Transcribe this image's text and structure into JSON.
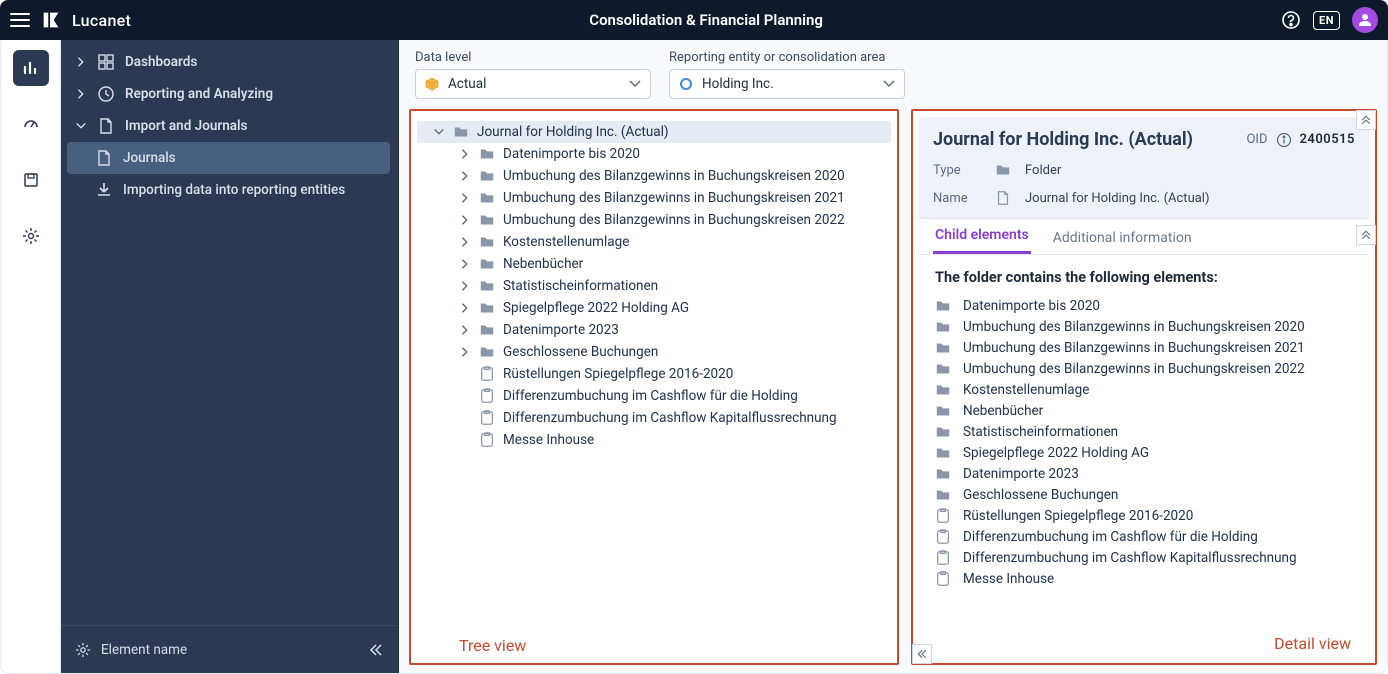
{
  "brand": "Lucanet",
  "app_title": "Consolidation & Financial Planning",
  "lang": "EN",
  "nav": {
    "items": [
      {
        "label": "Dashboards",
        "expandable": true,
        "open": false,
        "icon": "dashboard"
      },
      {
        "label": "Reporting and Analyzing",
        "expandable": true,
        "open": false,
        "icon": "clock"
      },
      {
        "label": "Import and Journals",
        "expandable": true,
        "open": true,
        "icon": "doc",
        "children": [
          {
            "label": "Journals",
            "icon": "doc",
            "active": true
          },
          {
            "label": "Importing data into reporting entities",
            "icon": "download"
          }
        ]
      }
    ],
    "footer_label": "Element name"
  },
  "filters": {
    "data_level": {
      "label": "Data level",
      "value": "Actual"
    },
    "entity": {
      "label": "Reporting entity or consolidation area",
      "value": "Holding Inc."
    }
  },
  "tree": {
    "root": "Journal for Holding Inc. (Actual)",
    "children": [
      {
        "label": "Datenimporte bis 2020",
        "type": "folder",
        "exp": true
      },
      {
        "label": "Umbuchung des Bilanzgewinns in Buchungskreisen 2020",
        "type": "folder",
        "exp": true
      },
      {
        "label": "Umbuchung des Bilanzgewinns in Buchungskreisen 2021",
        "type": "folder",
        "exp": true
      },
      {
        "label": "Umbuchung des Bilanzgewinns in Buchungskreisen 2022",
        "type": "folder",
        "exp": true
      },
      {
        "label": "Kostenstellenumlage",
        "type": "folder",
        "exp": true
      },
      {
        "label": "Nebenbücher",
        "type": "folder",
        "exp": true
      },
      {
        "label": "Statistischeinformationen",
        "type": "folder",
        "exp": true
      },
      {
        "label": "Spiegelpflege 2022 Holding AG",
        "type": "folder",
        "exp": true
      },
      {
        "label": "Datenimporte 2023",
        "type": "folder",
        "exp": true
      },
      {
        "label": "Geschlossene Buchungen",
        "type": "folder",
        "exp": true
      },
      {
        "label": "Rüstellungen Spiegelpflege 2016-2020",
        "type": "posting",
        "exp": false
      },
      {
        "label": "Differenzumbuchung im Cashflow für die Holding",
        "type": "posting",
        "exp": false
      },
      {
        "label": "Differenzumbuchung im Cashflow Kapitalflussrechnung",
        "type": "posting",
        "exp": false
      },
      {
        "label": "Messe Inhouse",
        "type": "posting",
        "exp": false
      }
    ],
    "caption": "Tree view"
  },
  "detail": {
    "title": "Journal for Holding Inc. (Actual)",
    "oid_label": "OID",
    "oid": "2400515",
    "type_label": "Type",
    "type_value": "Folder",
    "name_label": "Name",
    "name_value": "Journal for Holding Inc. (Actual)",
    "tabs": {
      "child": "Child elements",
      "info": "Additional information"
    },
    "list_heading": "The folder contains the following elements:",
    "elements": [
      {
        "label": "Datenimporte bis 2020",
        "type": "folder"
      },
      {
        "label": "Umbuchung des Bilanzgewinns in Buchungskreisen 2020",
        "type": "folder"
      },
      {
        "label": "Umbuchung des Bilanzgewinns in Buchungskreisen 2021",
        "type": "folder"
      },
      {
        "label": "Umbuchung des Bilanzgewinns in Buchungskreisen 2022",
        "type": "folder"
      },
      {
        "label": "Kostenstellenumlage",
        "type": "folder"
      },
      {
        "label": "Nebenbücher",
        "type": "folder"
      },
      {
        "label": "Statistischeinformationen",
        "type": "folder"
      },
      {
        "label": "Spiegelpflege 2022 Holding AG",
        "type": "folder"
      },
      {
        "label": "Datenimporte 2023",
        "type": "folder"
      },
      {
        "label": "Geschlossene Buchungen",
        "type": "folder"
      },
      {
        "label": "Rüstellungen Spiegelpflege 2016-2020",
        "type": "posting"
      },
      {
        "label": "Differenzumbuchung im Cashflow für die Holding",
        "type": "posting"
      },
      {
        "label": "Differenzumbuchung im Cashflow Kapitalflussrechnung",
        "type": "posting"
      },
      {
        "label": "Messe Inhouse",
        "type": "posting"
      }
    ],
    "caption": "Detail view"
  }
}
